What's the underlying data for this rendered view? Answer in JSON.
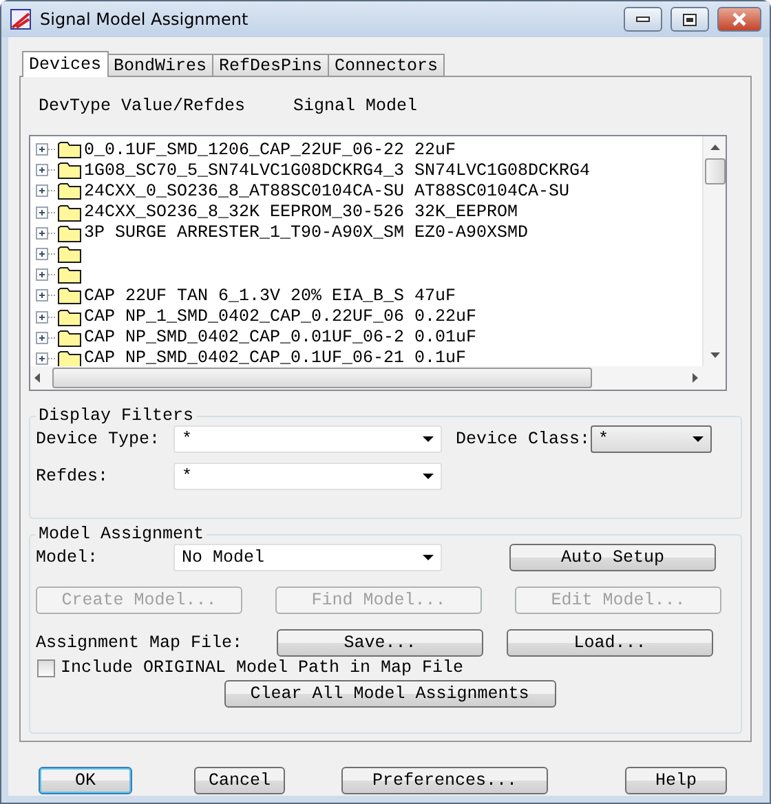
{
  "window": {
    "title": "Signal Model Assignment"
  },
  "tabs": [
    {
      "label": "Devices",
      "selected": true
    },
    {
      "label": "BondWires",
      "selected": false
    },
    {
      "label": "RefDesPins",
      "selected": false
    },
    {
      "label": "Connectors",
      "selected": false
    }
  ],
  "device_list": {
    "headers": [
      "DevType Value/Refdes",
      "Signal Model"
    ],
    "rows": [
      {
        "label": "0_0.1UF_SMD_1206_CAP_22UF_06-22 22uF",
        "expanded": false
      },
      {
        "label": "1G08_SC70_5_SN74LVC1G08DCKRG4_3 SN74LVC1G08DCKRG4",
        "expanded": false
      },
      {
        "label": "24CXX_0_SO236_8_AT88SC0104CA-SU AT88SC0104CA-SU",
        "expanded": false
      },
      {
        "label": "24CXX_SO236_8_32K EEPROM_30-526 32K_EEPROM",
        "expanded": false
      },
      {
        "label": "3P SURGE ARRESTER_1_T90-A90X_SM EZ0-A90XSMD",
        "expanded": false
      },
      {
        "expanded": false
      },
      {
        "expanded": false
      },
      {
        "label": "CAP 22UF TAN 6_1.3V 20% EIA_B_S 47uF",
        "expanded": false
      },
      {
        "label": "CAP NP_1_SMD_0402_CAP_0.22UF_06 0.22uF",
        "expanded": false
      },
      {
        "label": "CAP NP_SMD_0402_CAP_0.01UF_06-2 0.01uF",
        "expanded": false
      },
      {
        "label": "CAP NP_SMD_0402_CAP_0.1UF_06-21 0.1uF",
        "expanded": false
      }
    ]
  },
  "display_filters": {
    "title": "Display Filters",
    "device_type": {
      "label": "Device Type:",
      "value": "*"
    },
    "device_class": {
      "label": "Device Class:",
      "value": "*"
    },
    "refdes": {
      "label": "Refdes:",
      "value": "*"
    }
  },
  "model_assignment": {
    "title": "Model Assignment",
    "model": {
      "label": "Model:",
      "value": "No Model"
    },
    "auto_setup": {
      "label": "Auto Setup",
      "disabled": false
    },
    "model_buttons": [
      {
        "label": "Create Model...",
        "disabled": true
      },
      {
        "label": "Find Model...",
        "disabled": true
      },
      {
        "label": "Edit Model...",
        "disabled": true
      }
    ],
    "map_file": {
      "label": "Assignment Map File:",
      "save": "Save...",
      "load": "Load..."
    },
    "include_path": {
      "label": "Include ORIGINAL Model Path in Map File",
      "checked": false
    },
    "clear_all": "Clear All Model Assignments"
  },
  "footer_buttons": [
    {
      "label": "OK",
      "focused": true
    },
    {
      "label": "Cancel",
      "focused": false
    },
    {
      "label": "Preferences...",
      "focused": false
    },
    {
      "label": "Help",
      "focused": false
    }
  ]
}
